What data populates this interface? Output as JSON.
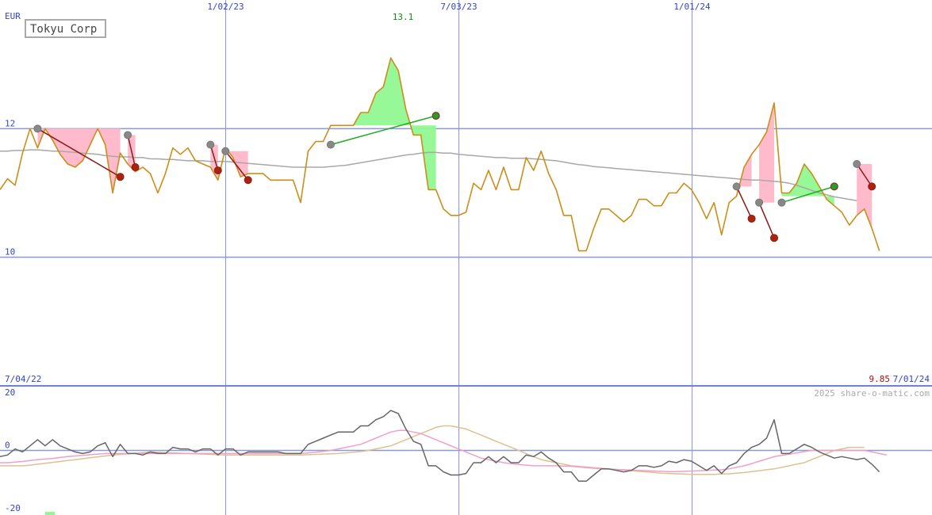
{
  "chart_data": [
    {
      "type": "line",
      "title": "Tokyu Corp",
      "currency": "EUR",
      "high_label": "13.1",
      "last_label": "9.85",
      "start_date": "7/04/22",
      "end_date": "7/01/24",
      "date_ticks": [
        {
          "label": "1/02/23",
          "index": 30
        },
        {
          "label": "7/03/23",
          "index": 61
        },
        {
          "label": "1/01/24",
          "index": 92
        }
      ],
      "y_ticks": [
        {
          "label": "12",
          "value": 12
        },
        {
          "label": "10",
          "value": 10
        }
      ],
      "ylim": [
        8,
        14.0
      ],
      "x_count": 125,
      "colors": {
        "price": "#cc8e1a",
        "moving_average": "#a8a8a8",
        "win": "#90f890",
        "loss": "#ffb6c8",
        "win_line": "#22aa22",
        "loss_line": "#8b1a1a",
        "grid": "#8899dd",
        "axis": "#7080dd"
      },
      "series": [
        {
          "key": "price",
          "values": [
            11.05,
            11.22,
            11.12,
            11.62,
            12.0,
            11.7,
            12.0,
            11.82,
            11.6,
            11.45,
            11.4,
            11.5,
            11.75,
            12.0,
            11.75,
            11.0,
            11.62,
            11.45,
            11.33,
            11.4,
            11.3,
            11.0,
            11.3,
            11.7,
            11.6,
            11.7,
            11.5,
            11.45,
            11.4,
            11.2,
            11.7,
            11.55,
            11.25,
            11.3,
            11.3,
            11.3,
            11.2,
            11.2,
            11.2,
            11.2,
            10.85,
            11.65,
            11.8,
            11.8,
            12.05,
            12.05,
            12.05,
            12.05,
            12.25,
            12.25,
            12.55,
            12.65,
            13.1,
            12.9,
            12.3,
            11.9,
            11.9,
            11.05,
            11.05,
            10.75,
            10.65,
            10.65,
            10.7,
            11.15,
            11.05,
            11.35,
            11.05,
            11.4,
            11.05,
            11.05,
            11.55,
            11.35,
            11.65,
            11.3,
            11.05,
            10.65,
            10.65,
            10.1,
            10.1,
            10.45,
            10.75,
            10.75,
            10.65,
            10.55,
            10.65,
            10.9,
            10.9,
            10.8,
            10.8,
            11.0,
            11.0,
            11.15,
            11.05,
            10.85,
            10.6,
            10.85,
            10.35,
            10.85,
            10.95,
            11.4,
            11.6,
            11.75,
            11.95,
            12.4,
            11.0,
            11.0,
            11.15,
            11.45,
            11.3,
            11.1,
            10.9,
            10.8,
            10.7,
            10.5,
            10.65,
            10.75,
            10.45,
            10.1
          ],
          "x_start": 0,
          "x_end": 125
        },
        {
          "key": "moving_average",
          "values": [
            11.65,
            11.65,
            11.66,
            11.66,
            11.67,
            11.67,
            11.66,
            11.65,
            11.65,
            11.64,
            11.63,
            11.62,
            11.61,
            11.6,
            11.58,
            11.57,
            11.56,
            11.56,
            11.55,
            11.55,
            11.53,
            11.53,
            11.52,
            11.52,
            11.51,
            11.5,
            11.5,
            11.5,
            11.49,
            11.49,
            11.49,
            11.48,
            11.47,
            11.46,
            11.45,
            11.44,
            11.43,
            11.42,
            11.41,
            11.4,
            11.4,
            11.4,
            11.4,
            11.4,
            11.41,
            11.42,
            11.43,
            11.45,
            11.47,
            11.49,
            11.51,
            11.53,
            11.55,
            11.57,
            11.59,
            11.6,
            11.62,
            11.63,
            11.63,
            11.62,
            11.62,
            11.6,
            11.59,
            11.58,
            11.57,
            11.56,
            11.55,
            11.55,
            11.54,
            11.54,
            11.54,
            11.53,
            11.52,
            11.51,
            11.5,
            11.48,
            11.46,
            11.44,
            11.43,
            11.41,
            11.4,
            11.39,
            11.38,
            11.37,
            11.36,
            11.35,
            11.34,
            11.33,
            11.32,
            11.31,
            11.3,
            11.29,
            11.28,
            11.27,
            11.26,
            11.25,
            11.24,
            11.23,
            11.22,
            11.21,
            11.2,
            11.2,
            11.19,
            11.18,
            11.17,
            11.15,
            11.12,
            11.08,
            11.04,
            11.0,
            10.97,
            10.94,
            10.92,
            10.9,
            10.88
          ],
          "x_start": 0,
          "x_end": 125
        }
      ],
      "trades": [
        {
          "type": "loss",
          "entry_index": 5,
          "entry_value": 12.0,
          "exit_index": 16,
          "exit_value": 11.25
        },
        {
          "type": "loss",
          "entry_index": 17,
          "entry_value": 11.9,
          "exit_index": 18,
          "exit_value": 11.4
        },
        {
          "type": "loss",
          "entry_index": 28,
          "entry_value": 11.75,
          "exit_index": 29,
          "exit_value": 11.35
        },
        {
          "type": "loss",
          "entry_index": 30,
          "entry_value": 11.65,
          "exit_index": 33,
          "exit_value": 11.2
        },
        {
          "type": "win",
          "entry_index": 44,
          "entry_value": 11.75,
          "exit_index": 58,
          "exit_value": 12.2
        },
        {
          "type": "loss",
          "entry_index": 98,
          "entry_value": 11.1,
          "exit_index": 100,
          "exit_value": 10.6
        },
        {
          "type": "loss",
          "entry_index": 101,
          "entry_value": 10.85,
          "exit_index": 103,
          "exit_value": 10.3
        },
        {
          "type": "win",
          "entry_index": 104,
          "entry_value": 10.85,
          "exit_index": 111,
          "exit_value": 11.1
        },
        {
          "type": "loss",
          "entry_index": 114,
          "entry_value": 11.45,
          "exit_index": 116,
          "exit_value": 11.1
        }
      ]
    },
    {
      "type": "line",
      "credit": "2025 share-o-matic.com",
      "y_ticks": [
        {
          "label": "20",
          "value": 20
        },
        {
          "label": "0",
          "value": 0
        },
        {
          "label": "-20",
          "value": -20
        }
      ],
      "ylim": [
        -20,
        20
      ],
      "colors": {
        "momentum": "#666666",
        "pink_avg": "#f0a0c8",
        "tan_avg": "#e0c090"
      },
      "series": [
        {
          "key": "momentum",
          "values": [
            -2.0,
            -1.5,
            0.5,
            -0.5,
            1.5,
            3.5,
            1.5,
            3.5,
            1.5,
            0.5,
            -0.5,
            -1.0,
            -0.5,
            1.5,
            2.5,
            -2.0,
            2.0,
            -1.0,
            -1.0,
            -1.5,
            -0.5,
            -1.0,
            -1.0,
            1.0,
            0.5,
            0.5,
            -0.5,
            0.5,
            0.5,
            -1.5,
            0.5,
            0.5,
            -1.5,
            -0.5,
            -0.5,
            -0.5,
            -0.5,
            -0.5,
            -1.0,
            -1.0,
            -1.0,
            2.0,
            3.0,
            4.0,
            5.0,
            6.0,
            6.0,
            6.0,
            8.0,
            8.0,
            10.0,
            11.0,
            13.0,
            12.0,
            7.0,
            3.0,
            2.0,
            -5.0,
            -5.0,
            -7.0,
            -8.0,
            -8.0,
            -7.5,
            -4.0,
            -4.0,
            -2.0,
            -4.0,
            -2.0,
            -4.0,
            -4.0,
            -1.5,
            -2.0,
            -0.5,
            -2.5,
            -4.0,
            -7.0,
            -7.0,
            -10.0,
            -10.0,
            -8.0,
            -6.0,
            -6.0,
            -6.5,
            -7.0,
            -6.5,
            -5.0,
            -5.0,
            -5.5,
            -5.0,
            -3.5,
            -4.0,
            -3.0,
            -3.5,
            -5.0,
            -6.5,
            -5.0,
            -7.5,
            -5.0,
            -4.0,
            -1.0,
            1.0,
            2.0,
            4.0,
            10.0,
            -1.0,
            -1.0,
            0.5,
            2.0,
            1.0,
            -0.5,
            -1.5,
            -2.5,
            -2.0,
            -2.5,
            -3.0,
            -2.5,
            -4.5,
            -7.0
          ],
          "x_start": 0,
          "x_end": 125
        },
        {
          "key": "pink_avg",
          "values": [
            -4.0,
            -4.0,
            -3.8,
            -3.6,
            -3.3,
            -3.0,
            -2.8,
            -2.6,
            -2.3,
            -2.0,
            -1.8,
            -1.6,
            -1.4,
            -1.2,
            -1.0,
            -1.0,
            -1.0,
            -1.0,
            -1.0,
            -1.0,
            -1.0,
            -1.0,
            -1.0,
            -1.0,
            -1.0,
            -1.0,
            -1.0,
            -1.0,
            -1.0,
            -1.0,
            -1.0,
            -1.0,
            -1.0,
            -1.0,
            -1.0,
            -1.0,
            -1.0,
            -1.0,
            -1.0,
            -1.0,
            -1.0,
            -0.8,
            -0.6,
            -0.3,
            0.0,
            0.5,
            1.0,
            1.5,
            2.0,
            3.0,
            4.0,
            5.0,
            6.0,
            6.5,
            6.5,
            6.0,
            5.5,
            4.5,
            3.5,
            2.5,
            1.5,
            0.5,
            -0.5,
            -1.5,
            -2.5,
            -3.0,
            -3.5,
            -4.0,
            -4.3,
            -4.6,
            -4.8,
            -5.0,
            -5.0,
            -5.0,
            -5.0,
            -5.1,
            -5.2,
            -5.4,
            -5.6,
            -5.8,
            -6.0,
            -6.1,
            -6.2,
            -6.3,
            -6.4,
            -6.5,
            -6.6,
            -6.7,
            -6.8,
            -6.9,
            -6.9,
            -6.8,
            -6.7,
            -6.6,
            -6.5,
            -6.4,
            -6.3,
            -6.0,
            -5.5,
            -5.0,
            -4.3,
            -3.5,
            -2.8,
            -2.0,
            -1.6,
            -1.2,
            -0.8,
            -0.4,
            0.0,
            0.0,
            0.0,
            0.0,
            0.0,
            0.0,
            0.0,
            0.0,
            -0.5,
            -1.0,
            -1.5
          ],
          "x_start": 0,
          "x_end": 125
        },
        {
          "key": "tan_avg",
          "values": [
            -5.0,
            -5.0,
            -5.0,
            -5.0,
            -4.8,
            -4.5,
            -4.2,
            -3.9,
            -3.6,
            -3.3,
            -3.0,
            -2.7,
            -2.4,
            -2.1,
            -1.8,
            -1.5,
            -1.3,
            -1.1,
            -0.9,
            -0.7,
            -0.5,
            -0.6,
            -0.7,
            -0.8,
            -0.9,
            -1.0,
            -1.1,
            -1.2,
            -1.3,
            -1.4,
            -1.5,
            -1.5,
            -1.5,
            -1.5,
            -1.5,
            -1.5,
            -1.5,
            -1.5,
            -1.5,
            -1.5,
            -1.5,
            -1.4,
            -1.3,
            -1.2,
            -1.1,
            -1.0,
            -0.8,
            -0.6,
            -0.4,
            0.0,
            0.5,
            1.0,
            1.5,
            2.5,
            3.5,
            4.5,
            5.5,
            6.5,
            7.5,
            8.0,
            8.0,
            7.5,
            7.0,
            6.0,
            5.0,
            4.0,
            3.0,
            2.0,
            1.0,
            0.0,
            -1.0,
            -2.0,
            -3.0,
            -3.5,
            -4.0,
            -4.5,
            -5.0,
            -5.2,
            -5.4,
            -5.6,
            -5.8,
            -6.0,
            -6.2,
            -6.4,
            -6.6,
            -6.8,
            -7.0,
            -7.2,
            -7.4,
            -7.5,
            -7.6,
            -7.7,
            -7.8,
            -7.8,
            -7.8,
            -7.8,
            -7.7,
            -7.6,
            -7.4,
            -7.2,
            -6.9,
            -6.6,
            -6.3,
            -6.0,
            -5.5,
            -5.0,
            -4.5,
            -4.0,
            -3.0,
            -2.0,
            -1.0,
            0.0,
            0.5,
            1.0,
            1.0,
            1.0
          ],
          "x_start": 0,
          "x_end": 125
        }
      ],
      "legend_marker": "#90f890"
    }
  ]
}
